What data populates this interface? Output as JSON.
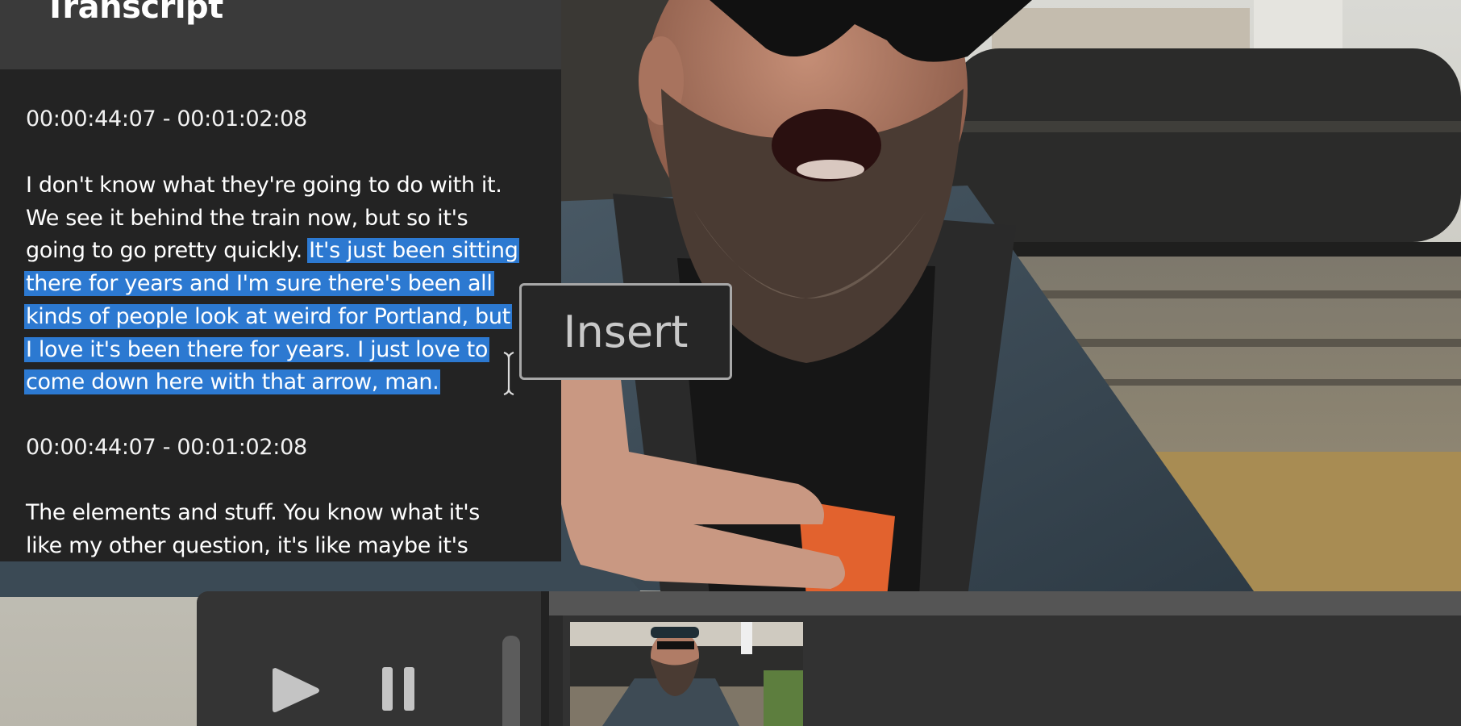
{
  "panel": {
    "title": "Transcript"
  },
  "transcript": [
    {
      "timestamp": "00:00:44:07 - 00:01:02:08",
      "lines": [
        {
          "text": "I don't know what they're going to do with it.",
          "highlight": ""
        },
        {
          "text": "We see it behind the train now, but so it's",
          "highlight": ""
        },
        {
          "text": "going to go pretty quickly. ",
          "highlight": "It's just been sitting"
        },
        {
          "text": "",
          "highlight": "there for years and I'm sure there's been all"
        },
        {
          "text": "",
          "highlight": "kinds of people look at weird for Portland, but"
        },
        {
          "text": "",
          "highlight": "I love it's been there for years. I just love to"
        },
        {
          "text": "",
          "highlight": "come down here with that arrow, man."
        }
      ]
    },
    {
      "timestamp": "00:00:44:07 - 00:01:02:08",
      "lines": [
        {
          "text": "The elements and stuff. You know what it's",
          "highlight": ""
        },
        {
          "text": "like my other question, it's like maybe it's",
          "highlight": ""
        }
      ]
    }
  ],
  "popup": {
    "insert_label": "Insert"
  },
  "icons": {
    "play": "play-icon",
    "pause": "pause-icon",
    "cursor": "text-cursor-icon"
  },
  "colors": {
    "highlight": "#2c79d1",
    "panel_bg": "#232323",
    "header_bg": "#3a3a3a"
  }
}
